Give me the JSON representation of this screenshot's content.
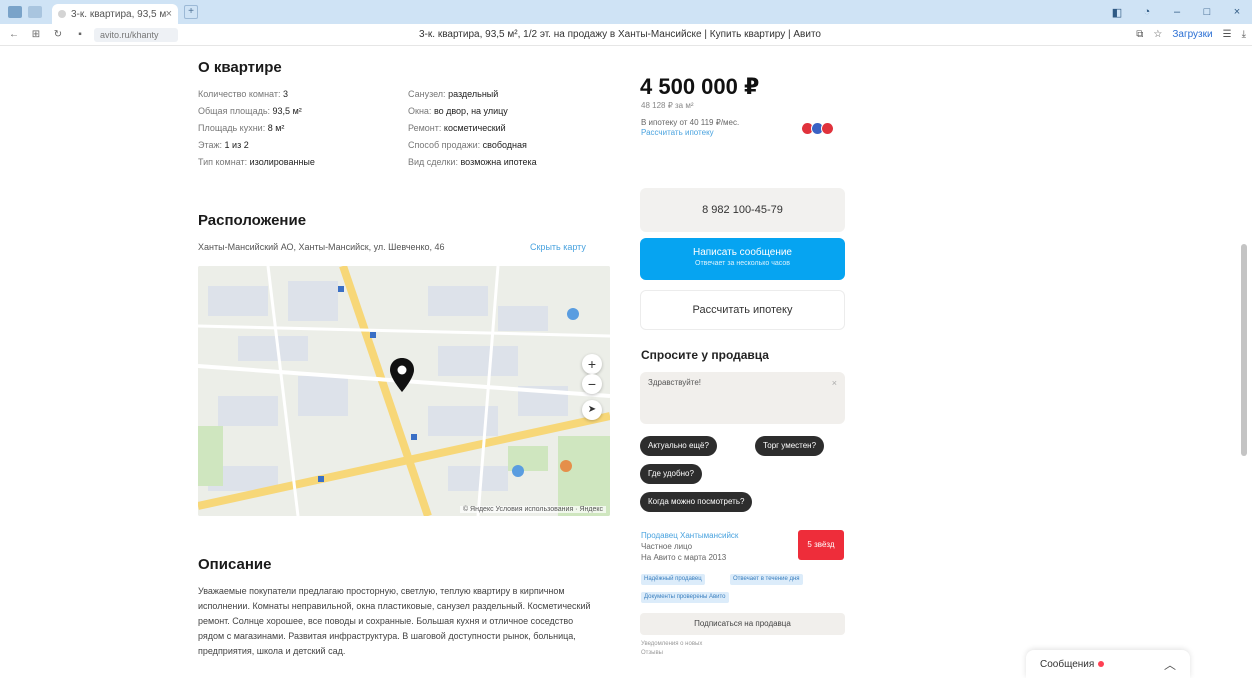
{
  "browser": {
    "tab_title": "3-к. квартира, 93,5 м²",
    "page_title": "3-к. квартира, 93,5 м², 1/2 эт. на продажу в Ханты-Мансийске | Купить квартиру | Авито",
    "site_label": "avito.ru/khanty",
    "downloads": "Загрузки"
  },
  "about": {
    "title": "О квартире",
    "left": [
      {
        "k": "Количество комнат:",
        "v": "3"
      },
      {
        "k": "Общая площадь:",
        "v": "93,5 м²"
      },
      {
        "k": "Площадь кухни:",
        "v": "8 м²"
      },
      {
        "k": "Этаж:",
        "v": "1 из 2"
      },
      {
        "k": "Тип комнат:",
        "v": "изолированные"
      }
    ],
    "right": [
      {
        "k": "Санузел:",
        "v": "раздельный"
      },
      {
        "k": "Окна:",
        "v": "во двор, на улицу"
      },
      {
        "k": "Ремонт:",
        "v": "косметический"
      },
      {
        "k": "Способ продажи:",
        "v": "свободная"
      },
      {
        "k": "Вид сделки:",
        "v": "возможна ипотека"
      }
    ]
  },
  "location": {
    "title": "Расположение",
    "address": "Ханты-Мансийский АО, Ханты-Мансийск, ул. Шевченко, 46",
    "show_map": "Скрыть карту",
    "copyright": "© Яндекс Условия использования · Яндекс"
  },
  "description": {
    "title": "Описание",
    "text": "Уважаемые покупатели предлагаю просторную, светлую, теплую квартиру в кирпичном исполнении. Комнаты неправильной, окна пластиковые, санузел раздельный. Косметический ремонт. Солнце хорошее, все поводы и сохранные. Большая кухня и отличное соседство рядом с магазинами. Развитая инфраструктура. В шаговой доступности рынок, больница, предприятия, школа и детский сад."
  },
  "sidebar": {
    "price": "4 500 000 ₽",
    "price_per_m2": "48 128 ₽ за м²",
    "mortgage_line": "В ипотеку от 40 119 ₽/мес.",
    "mortgage_link": "Рассчитать ипотеку",
    "phone": "8 982 100-45-79",
    "write_button": "Написать сообщение",
    "write_sub": "Отвечает за несколько часов",
    "calc_button": "Рассчитать ипотеку",
    "ask_title": "Спросите у продавца",
    "ask_placeholder": "Здравствуйте!",
    "chips": [
      "Актуально ещё?",
      "Торг уместен?",
      "Где удобно?",
      "Когда можно посмотреть?"
    ],
    "seller_name": "Продавец Хантымансийск",
    "seller_role": "Частное лицо",
    "seller_since": "На Авито с марта 2013",
    "seller_badge": "5 звёзд",
    "tags": [
      "Надёжный продавец",
      "Отвечает в течение дня",
      "Документы проверены Авито"
    ],
    "subscribe": "Подписаться на продавца",
    "note1": "Уведомления о новых",
    "note2": "Отзывы"
  },
  "messenger": {
    "label": "Сообщения"
  }
}
